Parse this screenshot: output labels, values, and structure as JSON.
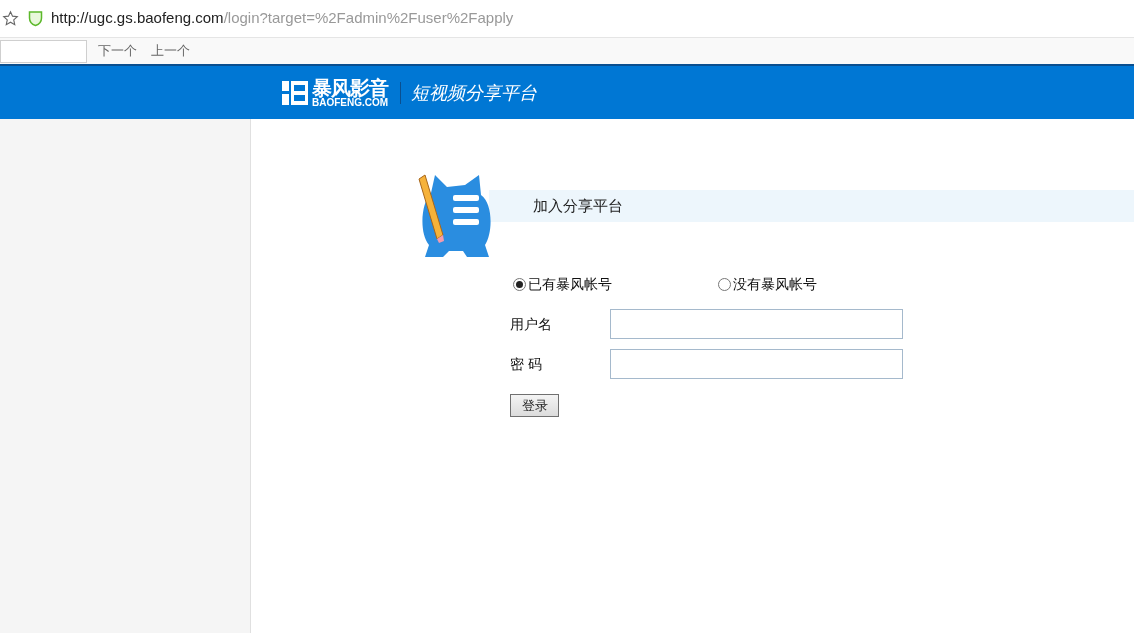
{
  "browser": {
    "url_host": "http://ugc.gs.baofeng.com",
    "url_path": "/login?target=%2Fadmin%2Fuser%2Fapply"
  },
  "find_bar": {
    "buttons": [
      "下一个",
      "上一个"
    ]
  },
  "header": {
    "logo_text": "暴风影音",
    "logo_domain": "BAOFENG.COM",
    "tagline": "短视频分享平台"
  },
  "form": {
    "title": "加入分享平台",
    "account_options": [
      {
        "label": "已有暴风帐号",
        "selected": true
      },
      {
        "label": "没有暴风帐号",
        "selected": false
      }
    ],
    "fields": [
      {
        "label": "用户名"
      },
      {
        "label": "密 码"
      }
    ],
    "submit": "登录"
  }
}
